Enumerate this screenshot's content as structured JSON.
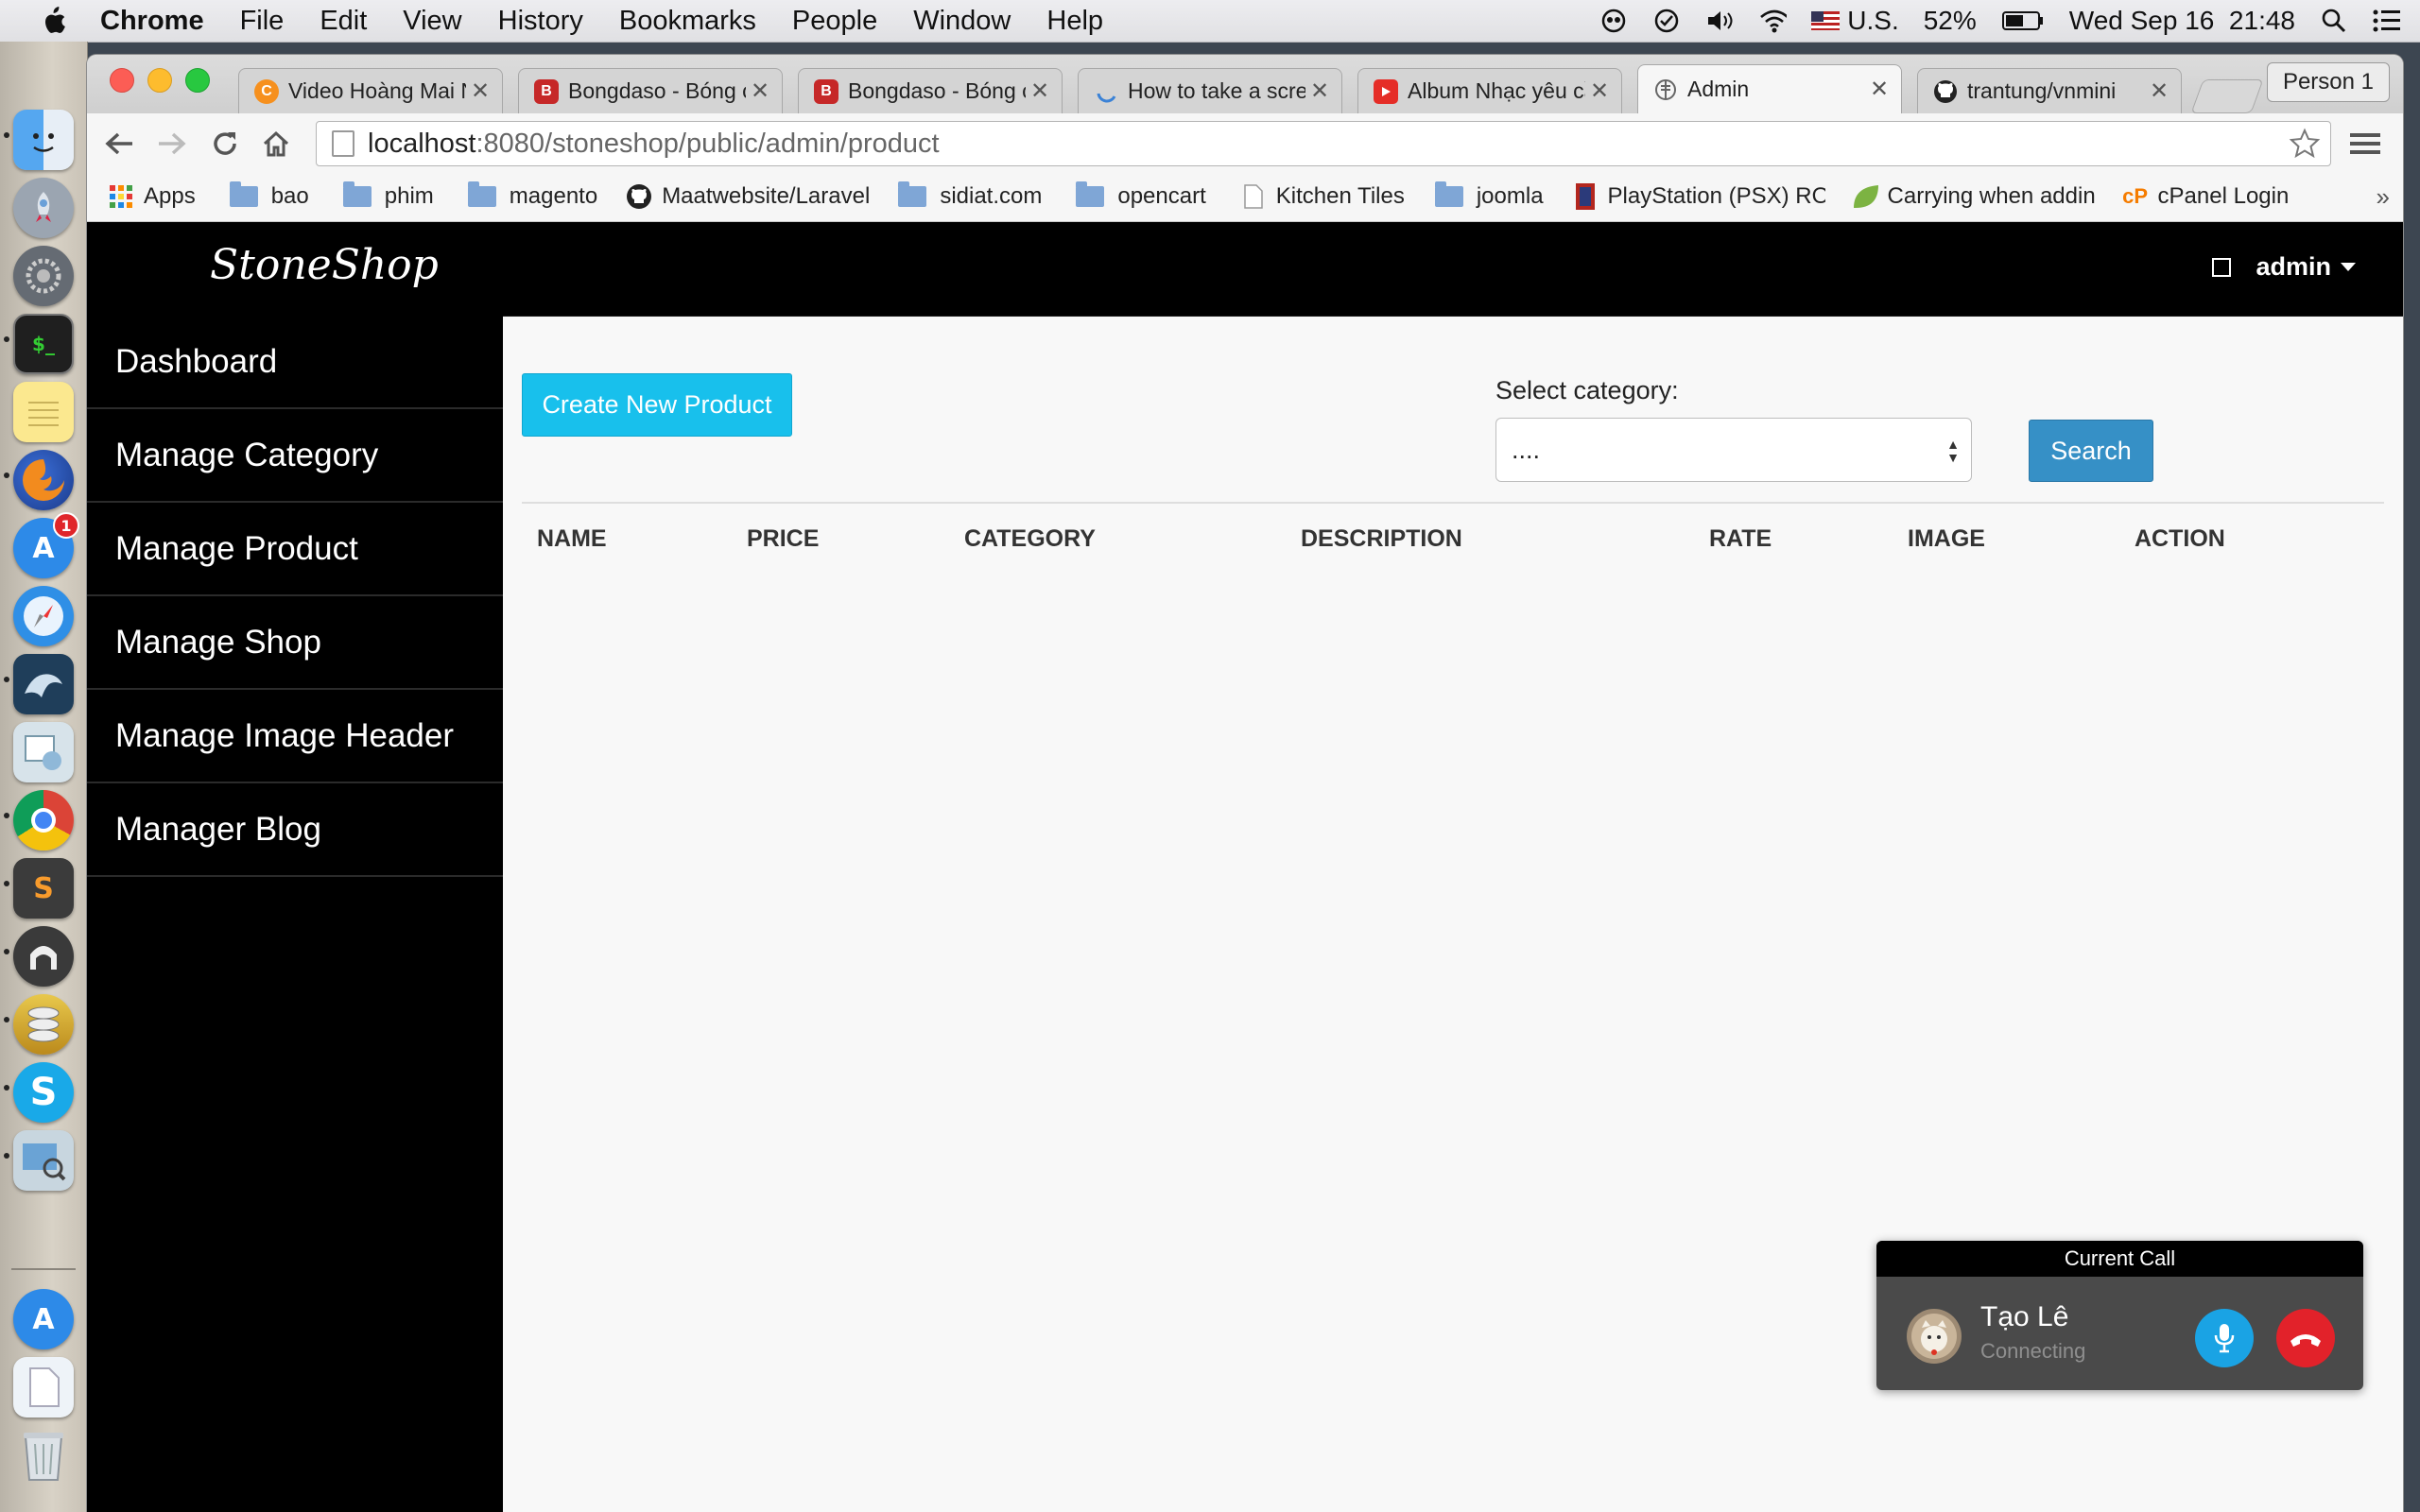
{
  "menubar": {
    "app_name": "Chrome",
    "items": [
      "File",
      "Edit",
      "View",
      "History",
      "Bookmarks",
      "People",
      "Window",
      "Help"
    ],
    "input_source": "U.S.",
    "battery": "52%",
    "clock": "Wed Sep 16  21:48"
  },
  "browser": {
    "tabs": [
      {
        "label": "Video Hoàng Mai N",
        "icon": "coccoc-icon"
      },
      {
        "label": "Bongdaso - Bóng c",
        "icon": "bongdaso-icon"
      },
      {
        "label": "Bongdaso - Bóng c",
        "icon": "bongdaso-icon"
      },
      {
        "label": "How to take a scre",
        "icon": "loading-icon"
      },
      {
        "label": "Album Nhạc yêu cầ",
        "icon": "youtube-icon"
      },
      {
        "label": "Admin",
        "icon": "globe-icon"
      },
      {
        "label": "trantung/vnmini",
        "icon": "github-icon"
      }
    ],
    "profile": "Person 1",
    "url_host": "localhost",
    "url_rest": ":8080/stoneshop/public/admin/product",
    "bookmarks": [
      "Apps",
      "bao",
      "phim",
      "magento",
      "Maatwebsite/Laravel",
      "sidiat.com",
      "opencart",
      "Kitchen Tiles",
      "joomla",
      "PlayStation (PSX) RO",
      "Carrying when adding",
      "cPanel Login"
    ]
  },
  "page": {
    "brand": "StoneShop",
    "user": "admin",
    "sidebar": [
      "Dashboard",
      "Manage Category",
      "Manage Product",
      "Manage Shop",
      "Manage Image Header",
      "Manager Blog"
    ],
    "create_button": "Create New Product",
    "select_label": "Select category:",
    "select_value": "....",
    "search_button": "Search",
    "columns": [
      "NAME",
      "PRICE",
      "CATEGORY",
      "DESCRIPTION",
      "RATE",
      "IMAGE",
      "ACTION"
    ]
  },
  "call": {
    "header": "Current Call",
    "name": "Tạo Lê",
    "status": "Connecting"
  },
  "colors": {
    "create_button": "#18c0ec",
    "search_button": "#3690c6",
    "call_end": "#e2222a",
    "call_mic": "#1aa3e4"
  }
}
